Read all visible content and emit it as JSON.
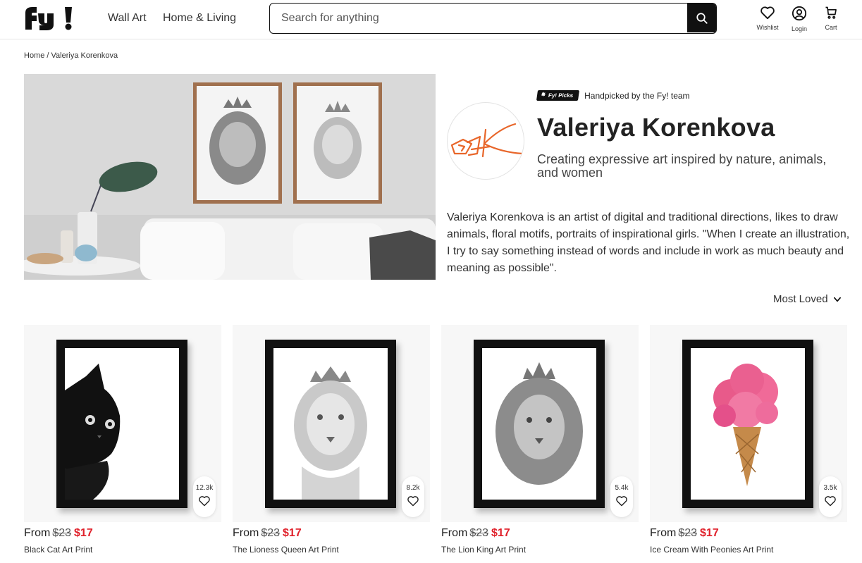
{
  "header": {
    "nav": [
      "Wall Art",
      "Home & Living"
    ],
    "search_placeholder": "Search for anything",
    "icons": [
      {
        "label": "Wishlist",
        "icon": "heart-icon"
      },
      {
        "label": "Login",
        "icon": "user-icon"
      },
      {
        "label": "Cart",
        "icon": "cart-icon"
      }
    ]
  },
  "breadcrumb": {
    "home": "Home",
    "separator": " / ",
    "current": "Valeriya Korenkova"
  },
  "artist": {
    "badge": "Fy! Picks",
    "badge_text": "Handpicked by the Fy! team",
    "name": "Valeriya Korenkova",
    "tagline": "Creating expressive art inspired by nature, animals, and women",
    "bio": "Valeriya Korenkova is an artist of digital and traditional directions, likes to draw animals, floral motifs, portraits of inspirational girls. \"When I create an illustration, I try to say something instead of words and include in work as much beauty and meaning as possible\".",
    "avatar_color": "#e8662a"
  },
  "sort": {
    "label": "Most Loved"
  },
  "products": [
    {
      "name": "Black Cat Art Print",
      "from": "From",
      "old_price": "$23",
      "price": "$17",
      "loves": "12.3k"
    },
    {
      "name": "The Lioness Queen Art Print",
      "from": "From",
      "old_price": "$23",
      "price": "$17",
      "loves": "8.2k"
    },
    {
      "name": "The Lion King Art Print",
      "from": "From",
      "old_price": "$23",
      "price": "$17",
      "loves": "5.4k"
    },
    {
      "name": "Ice Cream With Peonies Art Print",
      "from": "From",
      "old_price": "$23",
      "price": "$17",
      "loves": "3.5k"
    }
  ],
  "colors": {
    "accent_price": "#e0202a",
    "brand_black": "#111111"
  }
}
